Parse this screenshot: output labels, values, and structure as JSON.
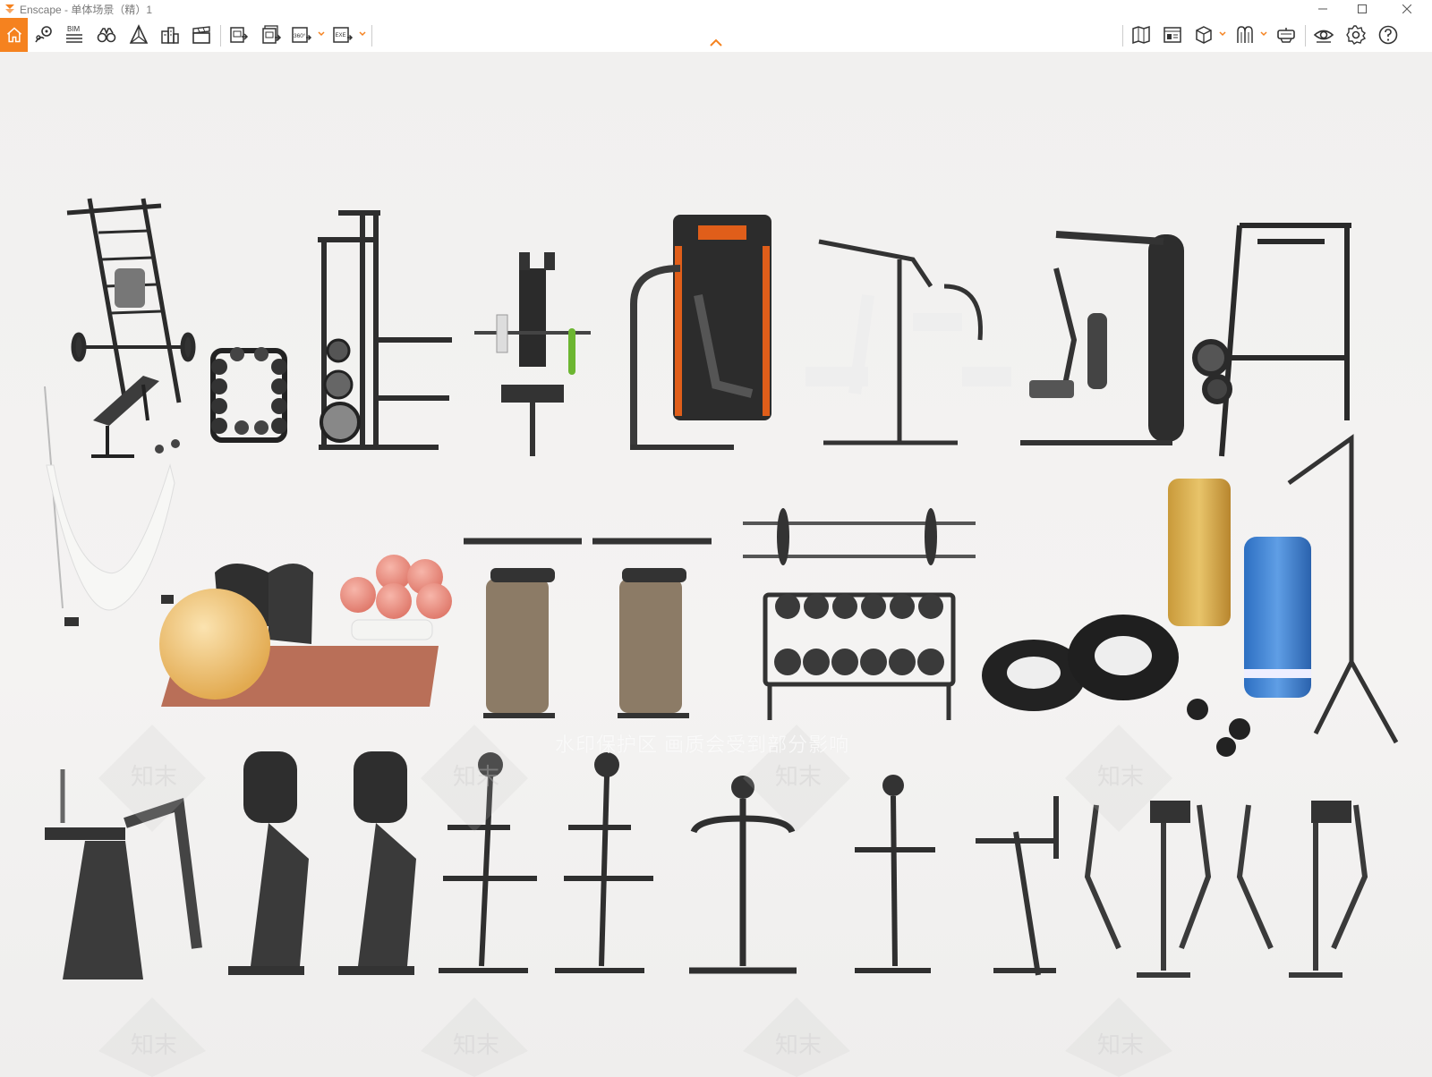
{
  "window": {
    "title": "Enscape - 单体场景（精）1",
    "accent": "#f5821f"
  },
  "toolbar": {
    "left_icons": [
      "home-icon",
      "location-icon",
      "bim-icon",
      "binoculars-icon",
      "perspective-icon",
      "buildings-icon",
      "clapper-icon",
      "render-image-icon",
      "batch-render-icon",
      "panorama-360-icon",
      "export-exe-icon"
    ],
    "bim_label": "BIM",
    "pano_label": "360°",
    "exe_label": "EXE",
    "right_icons": [
      "map-icon",
      "asset-library-icon",
      "material-cube-icon",
      "sky-icon",
      "vr-headset-icon",
      "view-eye-icon",
      "settings-gear-icon",
      "help-icon"
    ]
  },
  "viewport": {
    "watermark_text": "水印保护区 画质会受到部分影响",
    "logo_text": "知末"
  }
}
